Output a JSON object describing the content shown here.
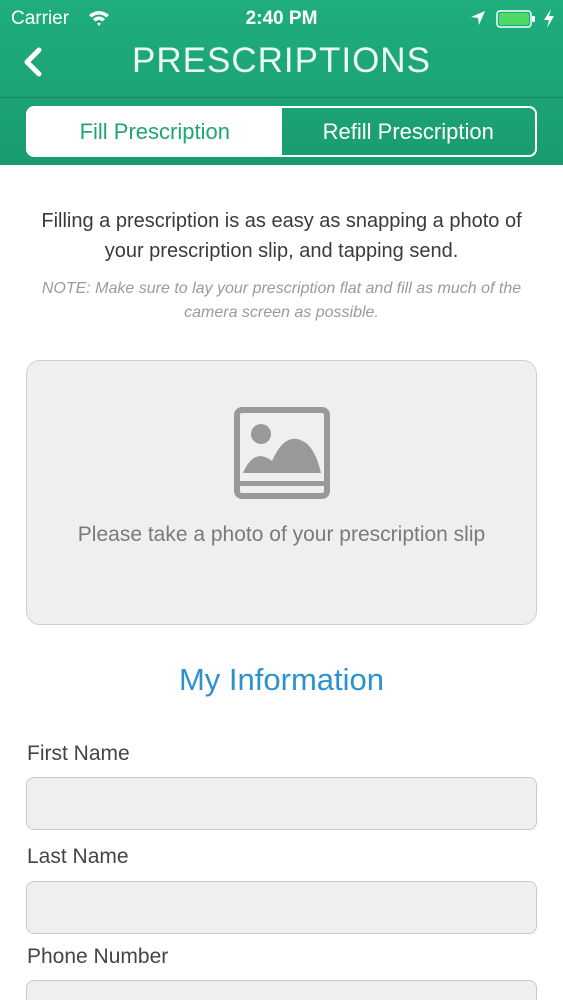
{
  "status_bar": {
    "carrier": "Carrier",
    "time": "2:40 PM",
    "icons": [
      "wifi-icon",
      "location-icon",
      "battery-icon",
      "charging-icon"
    ]
  },
  "nav": {
    "title": "PRESCRIPTIONS",
    "back_icon": "chevron-left-icon"
  },
  "tabs": [
    {
      "label": "Fill Prescription",
      "selected": true
    },
    {
      "label": "Refill Prescription",
      "selected": false
    }
  ],
  "content": {
    "intro": "Filling a prescription  is as easy as snapping a photo of your prescription slip, and tapping send.",
    "note": "NOTE: Make sure to lay your prescription flat and fill as much of the camera screen as possible.",
    "photo_box": {
      "icon": "image-placeholder-icon",
      "caption": "Please take a photo of your prescription slip"
    },
    "section_title": "My Information",
    "fields": [
      {
        "label": "First Name",
        "value": "",
        "placeholder": ""
      },
      {
        "label": "Last Name",
        "value": "",
        "placeholder": ""
      },
      {
        "label": "Phone Number",
        "value": "",
        "placeholder": ""
      }
    ]
  },
  "colors": {
    "header_green": "#1fae7d",
    "accent_blue": "#2a92cf",
    "field_bg": "#efeff1"
  }
}
